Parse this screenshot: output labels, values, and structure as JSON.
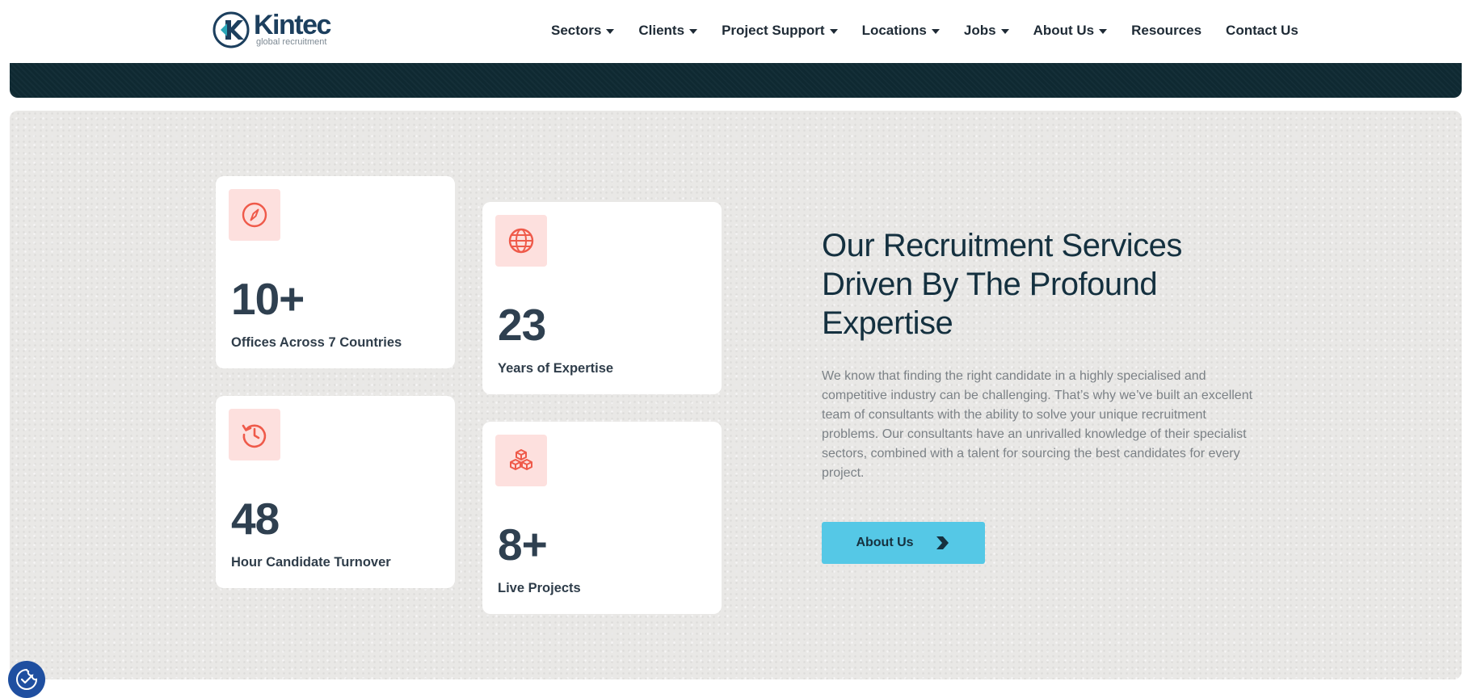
{
  "brand": {
    "name": "Kintec",
    "tagline": "global recruitment",
    "logo_color": "#1c3f5e",
    "accent_color": "#2aa7b8"
  },
  "nav": {
    "items": [
      {
        "label": "Sectors",
        "has_dropdown": true
      },
      {
        "label": "Clients",
        "has_dropdown": true
      },
      {
        "label": "Project Support",
        "has_dropdown": true
      },
      {
        "label": "Locations",
        "has_dropdown": true
      },
      {
        "label": "Jobs",
        "has_dropdown": true
      },
      {
        "label": "About Us",
        "has_dropdown": true
      },
      {
        "label": "Resources",
        "has_dropdown": false
      },
      {
        "label": "Contact Us",
        "has_dropdown": false
      }
    ]
  },
  "stats": [
    {
      "icon": "compass-icon",
      "value": "10+",
      "label": "Offices Across 7 Countries"
    },
    {
      "icon": "globe-icon",
      "value": "23",
      "label": "Years of Expertise"
    },
    {
      "icon": "history-clock-icon",
      "value": "48",
      "label": "Hour Candidate Turnover"
    },
    {
      "icon": "cubes-icon",
      "value": "8+",
      "label": "Live Projects"
    }
  ],
  "section": {
    "headline": "Our Recruitment Services Driven By The Profound Expertise",
    "body": "We know that finding the right candidate in a highly specialised and competitive industry can be challenging. That’s why we’ve built an excellent team of consultants with the ability to solve your unique recruitment problems. Our consultants have an unrivalled knowledge of their specialist sectors, combined with a talent for sourcing the best candidates for every project.",
    "cta_label": "About Us"
  },
  "colors": {
    "icon_accent": "#ef5a4a",
    "icon_bg": "#fde0de",
    "cta_bg": "#55c8e6",
    "hero_dark": "#0f2a33",
    "cookie_button": "#1f4fa0"
  },
  "cookie_button_icon": "cookie-consent-icon"
}
